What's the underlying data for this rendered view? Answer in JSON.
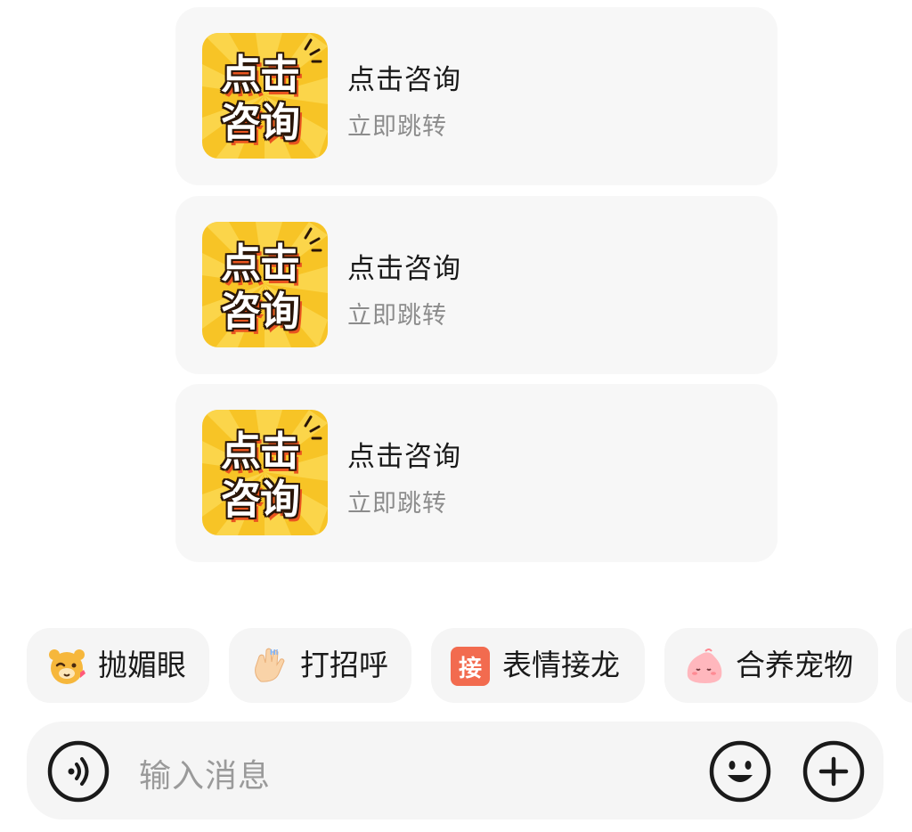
{
  "cards": [
    {
      "image_text_line1": "点击",
      "image_text_line2": "咨询",
      "title": "点击咨询",
      "subtitle": "立即跳转"
    },
    {
      "image_text_line1": "点击",
      "image_text_line2": "咨询",
      "title": "点击咨询",
      "subtitle": "立即跳转"
    },
    {
      "image_text_line1": "点击",
      "image_text_line2": "咨询",
      "title": "点击咨询",
      "subtitle": "立即跳转"
    }
  ],
  "quick_actions": [
    {
      "icon": "bear-wink-icon",
      "label": "抛媚眼"
    },
    {
      "icon": "waving-hand-icon",
      "label": "打招呼"
    },
    {
      "icon": "jie-badge-icon",
      "icon_text": "接",
      "label": "表情接龙"
    },
    {
      "icon": "pet-blob-icon",
      "label": "合养宠物"
    }
  ],
  "input": {
    "placeholder": "输入消息"
  },
  "colors": {
    "thumb_bg": "#f7c426",
    "card_bg": "#f7f7f7",
    "jie_badge": "#f26b4f"
  }
}
